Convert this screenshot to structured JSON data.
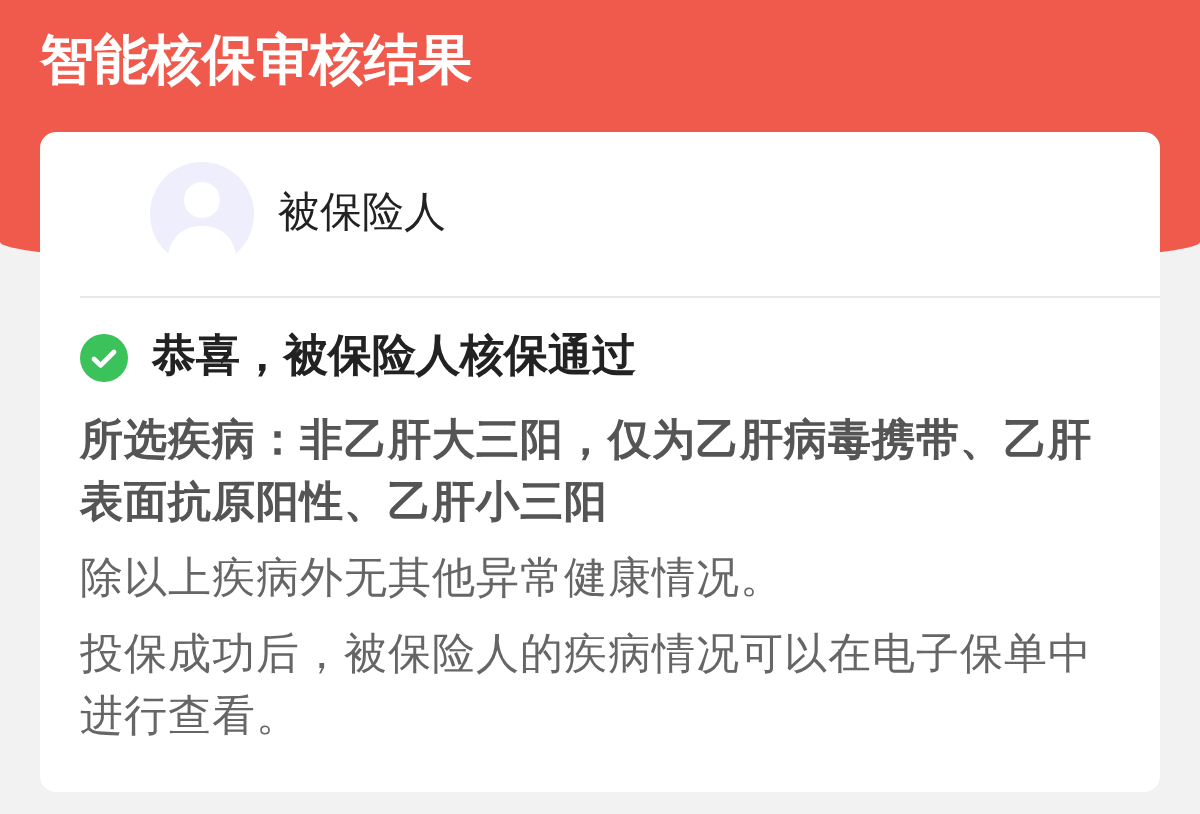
{
  "title": "智能核保审核结果",
  "insured": {
    "label": "被保险人"
  },
  "result": {
    "message": "恭喜，被保险人核保通过"
  },
  "details": [
    {
      "kind": "emphasis",
      "text": "所选疾病：非乙肝大三阳，仅为乙肝病毒携带、乙肝表面抗原阳性、乙肝小三阳"
    },
    {
      "kind": "plain",
      "text": "除以上疾病外无其他异常健康情况。"
    },
    {
      "kind": "plain",
      "text": "投保成功后，被保险人的疾病情况可以在电子保单中进行查看。"
    }
  ]
}
